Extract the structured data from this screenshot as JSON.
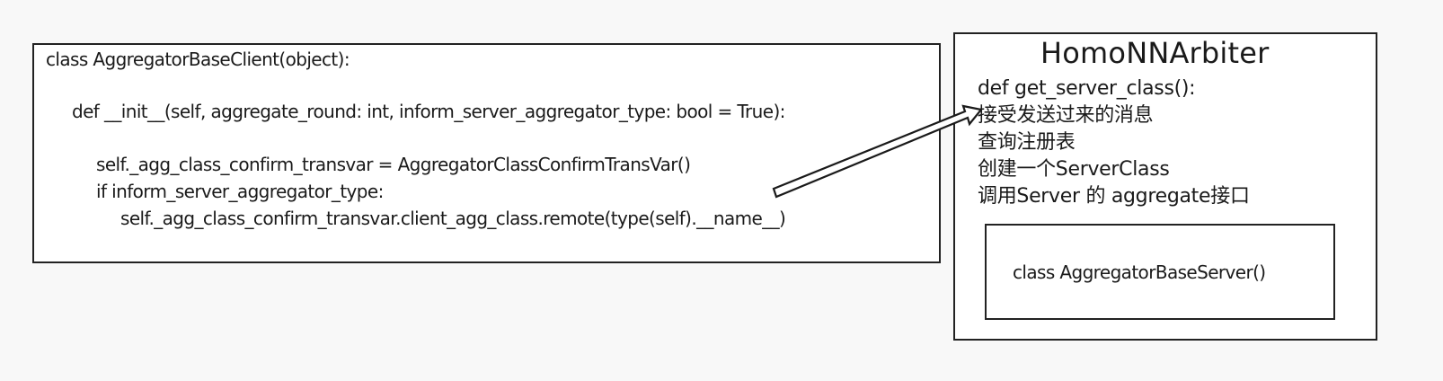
{
  "client": {
    "lines": [
      "class AggregatorBaseClient(object):",
      "def __init__(self, aggregate_round: int, inform_server_aggregator_type: bool = True):",
      "self._agg_class_confirm_transvar = AggregatorClassConfirmTransVar()",
      "if inform_server_aggregator_type:",
      "self._agg_class_confirm_transvar.client_agg_class.remote(type(self).__name__)"
    ]
  },
  "arbiter": {
    "title": "HomoNNArbiter",
    "lines": [
      "def get_server_class():",
      "接受发送过来的消息",
      "查询注册表",
      "创建一个ServerClass",
      "调用Server 的 aggregate接口"
    ],
    "server_class": "class AggregatorBaseServer()"
  },
  "colors": {
    "background": "#f8f8f8",
    "box_fill": "#ffffff",
    "stroke": "#222222"
  }
}
